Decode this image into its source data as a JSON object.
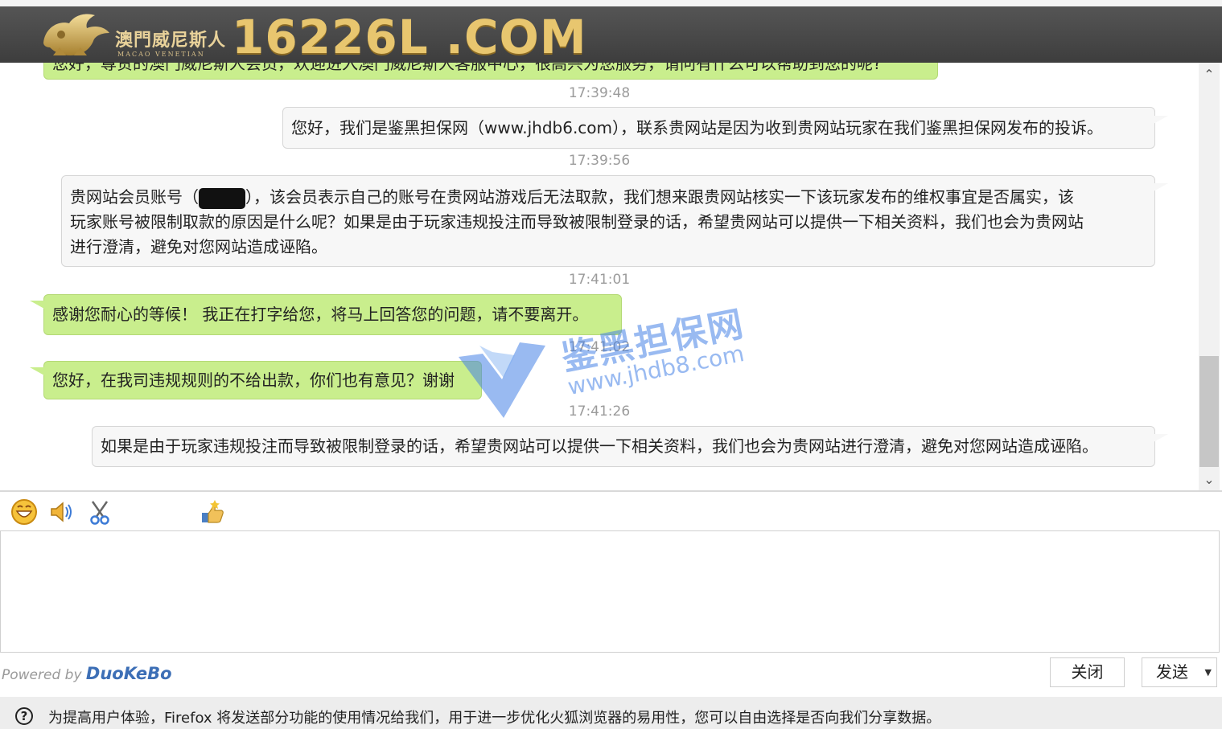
{
  "header": {
    "cn_name": "澳門威尼斯人",
    "en_name": "MACAO VENETIAN",
    "domain": "16226L .COM"
  },
  "messages": [
    {
      "type": "agent",
      "text": "您好，尊贵的澳门威尼斯人会员，欢迎进入澳门威尼斯人客服中心，很高兴为您服务，请问有什么可以帮助到您的呢?"
    },
    {
      "type": "timestamp",
      "text": "17:39:48"
    },
    {
      "type": "user",
      "text": "您好，我们是鉴黑担保网（www.jhdb6.com），联系贵网站是因为收到贵网站玩家在我们鉴黑担保网发布的投诉。"
    },
    {
      "type": "timestamp",
      "text": "17:39:56"
    },
    {
      "type": "user",
      "lines": [
        {
          "prefix": "贵网站会员账号（",
          "suffix": "），该会员表示自己的账号在贵网站游戏后无法取款，我们想来跟贵网站核实一下该玩家发布的维权事宜是否属实，该"
        },
        "玩家账号被限制取款的原因是什么呢？如果是由于玩家违规投注而导致被限制登录的话，希望贵网站可以提供一下相关资料，我们也会为贵网站",
        "进行澄清，避免对您网站造成诬陷。"
      ]
    },
    {
      "type": "timestamp",
      "text": "17:41:01"
    },
    {
      "type": "agent",
      "text": "感谢您耐心的等候！ 我正在打字给您，将马上回答您的问题，请不要离开。"
    },
    {
      "type": "timestamp",
      "text": "17:41:02"
    },
    {
      "type": "agent",
      "text": "您好，在我司违规规则的不给出款，你们也有意见？谢谢"
    },
    {
      "type": "timestamp",
      "text": "17:41:26"
    },
    {
      "type": "user",
      "text": "如果是由于玩家违规投注而导致被限制登录的话，希望贵网站可以提供一下相关资料，我们也会为贵网站进行澄清，避免对您网站造成诬陷。"
    }
  ],
  "watermark": {
    "title": "鉴黑担保网",
    "url": "www.jhdb8.com"
  },
  "toolbar": {
    "icons": [
      "emoji-icon",
      "sound-icon",
      "scissors-icon",
      "rating-icon"
    ]
  },
  "footer": {
    "powered_prefix": "Powered by ",
    "brand": "DuoKeBo",
    "close_label": "关闭",
    "send_label": "发送"
  },
  "notice": {
    "text": "为提高用户体验，Firefox 将发送部分功能的使用情况给我们，用于进一步优化火狐浏览器的易用性，您可以自由选择是否向我们分享数据。"
  },
  "colors": {
    "agent_bubble": "#c9ee8d",
    "user_bubble": "#f7f7f7",
    "banner": "#474747",
    "gold": "#e8c66f",
    "brand_blue": "#3d6fb6"
  }
}
